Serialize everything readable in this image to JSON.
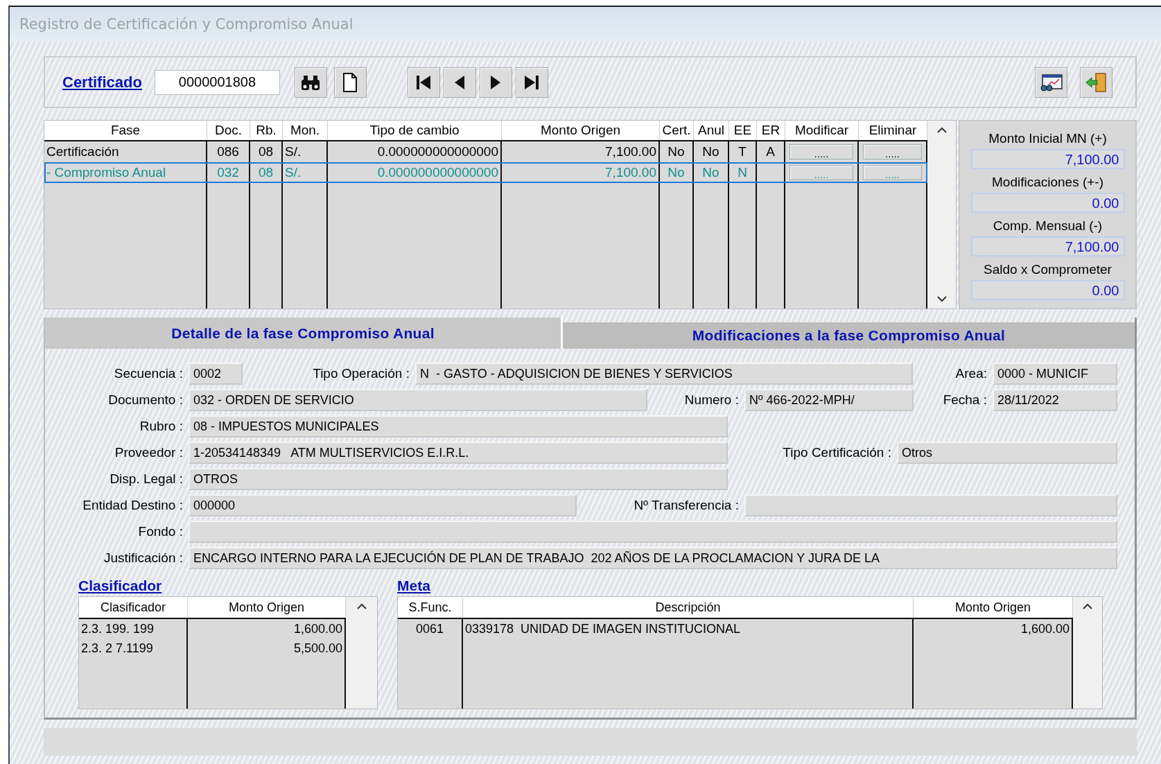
{
  "window": {
    "title": "Registro de Certificación y Compromiso Anual"
  },
  "toolbar": {
    "certificado_label": "Certificado",
    "certificado_value": "0000001808"
  },
  "phase_grid": {
    "columns": [
      "Fase",
      "Doc.",
      "Rb.",
      "Mon.",
      "Tipo de cambio",
      "Monto Origen",
      "Cert.",
      "Anul",
      "EE",
      "ER",
      "Modificar",
      "Eliminar"
    ],
    "rows": [
      {
        "fase": "Certificación",
        "doc": "086",
        "rb": "08",
        "mon": "S/.",
        "tipo_cambio": "0.000000000000000",
        "monto": "7,100.00",
        "cert": "No",
        "anul": "No",
        "ee": "T",
        "er": "A",
        "modificar": ".....",
        "eliminar": ".....",
        "selected": false
      },
      {
        "fase": "- Compromiso Anual",
        "doc": "032",
        "rb": "08",
        "mon": "S/.",
        "tipo_cambio": "0.000000000000000",
        "monto": "7,100.00",
        "cert": "No",
        "anul": "No",
        "ee": "N",
        "modificar": ".....",
        "eliminar": ".....",
        "selected": true
      }
    ]
  },
  "summary": [
    {
      "label": "Monto Inicial MN (+)",
      "value": "7,100.00"
    },
    {
      "label": "Modificaciones (+-)",
      "value": "0.00"
    },
    {
      "label": "Comp. Mensual (-)",
      "value": "7,100.00"
    },
    {
      "label": "Saldo x Comprometer",
      "value": "0.00"
    }
  ],
  "tabs": [
    {
      "label": "Detalle de la fase Compromiso Anual",
      "selected": true
    },
    {
      "label": "Modificaciones a la fase Compromiso Anual",
      "selected": false
    }
  ],
  "detail": {
    "rows": [
      [
        {
          "label": "Secuencia :",
          "value": "0002"
        },
        {
          "label": "Tipo Operación :",
          "value": "N  - GASTO - ADQUISICION DE BIENES Y SERVICIOS"
        },
        {
          "label": "Area:",
          "value": "0000 - MUNICIF"
        }
      ],
      [
        {
          "label": "Documento :",
          "value": "032 - ORDEN DE SERVICIO"
        },
        {
          "label": "Numero :",
          "value": "Nº 466-2022-MPH/"
        },
        {
          "label": "Fecha :",
          "value": "28/11/2022"
        }
      ],
      [
        {
          "label": "Rubro :",
          "value": "08 - IMPUESTOS MUNICIPALES"
        }
      ],
      [
        {
          "label": "Proveedor :",
          "value": "1-20534148349   ATM MULTISERVICIOS E.I.R.L."
        },
        {
          "label": "Tipo Certificación :",
          "value": "Otros"
        }
      ],
      [
        {
          "label": "Disp. Legal :",
          "value": "OTROS"
        }
      ],
      [
        {
          "label": "Entidad Destino :",
          "value": "000000"
        },
        {
          "label": "Nº Transferencia :"
        }
      ],
      [
        {
          "label": "Fondo :"
        }
      ],
      [
        {
          "label": "Justificación :",
          "value": "ENCARGO INTERNO PARA LA EJECUCIÓN DE PLAN DE TRABAJO  202 AÑOS DE LA PROCLAMACION Y JURA DE LA"
        }
      ]
    ]
  },
  "clasificador": {
    "title": "Clasificador",
    "columns": [
      "Clasificador",
      "Monto Origen"
    ],
    "rows": [
      [
        "2.3. 199. 199",
        "1,600.00"
      ],
      [
        "2.3. 2 7.1199",
        "5,500.00"
      ]
    ]
  },
  "meta": {
    "title": "Meta",
    "columns": [
      "S.Func.",
      "Descripción",
      "Monto Origen"
    ],
    "rows": [
      [
        "0061",
        "0339178  UNIDAD DE IMAGEN INSTITUCIONAL",
        "1,600.00"
      ]
    ]
  }
}
